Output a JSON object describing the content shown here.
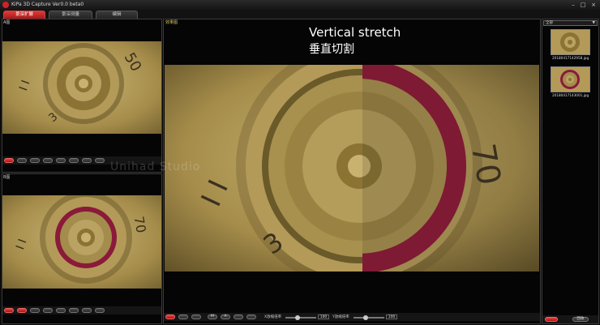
{
  "window": {
    "title": "KiPa 3D Capture Ver0.0 beta0",
    "controls": [
      "minimize-icon",
      "maximize-icon",
      "close-icon"
    ]
  },
  "tabs": [
    {
      "label": "景深扩展",
      "active": true
    },
    {
      "label": "景深测量",
      "active": false
    },
    {
      "label": "编辑",
      "active": false
    }
  ],
  "left_top": {
    "label": "A图"
  },
  "left_bottom": {
    "label": "B图"
  },
  "main": {
    "label": "效果图",
    "overlay_en": "Vertical stretch",
    "overlay_cn": "垂直切割",
    "watermark": "Unihad Studio"
  },
  "main_toolbar": {
    "buttons": [
      "",
      "",
      "",
      "M",
      "A",
      "",
      ""
    ],
    "slider1_label": "X放缩倍率",
    "slider1_value": "100",
    "slider2_label": "Y放缩倍率",
    "slider2_value": "100"
  },
  "right_panel": {
    "dropdown": "全部",
    "thumbnails": [
      {
        "caption": "20180417142958.jpg"
      },
      {
        "caption": "20180417143001.jpg"
      }
    ],
    "bottom_buttons": [
      "",
      "回收"
    ]
  },
  "colors": {
    "accent": "#c8202a",
    "background": "#0b0b0b",
    "brass": "#b59a55"
  }
}
